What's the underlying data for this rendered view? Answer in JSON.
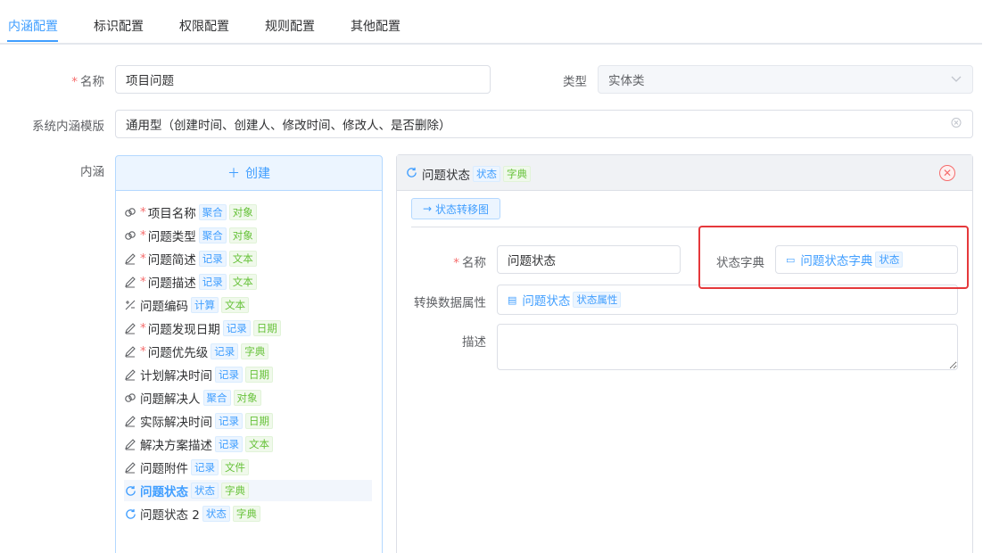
{
  "tabs": [
    {
      "label": "内涵配置",
      "active": true
    },
    {
      "label": "标识配置",
      "active": false
    },
    {
      "label": "权限配置",
      "active": false
    },
    {
      "label": "规则配置",
      "active": false
    },
    {
      "label": "其他配置",
      "active": false
    }
  ],
  "form": {
    "name_label": "名称",
    "name_value": "项目问题",
    "type_label": "类型",
    "type_value": "实体类",
    "template_label": "系统内涵模版",
    "template_value": "通用型（创建时间、创建人、修改时间、修改人、是否删除）",
    "connotation_label": "内涵",
    "create_button": "创建"
  },
  "items": [
    {
      "icon": "link-icon",
      "required": true,
      "label": "项目名称",
      "tags": [
        {
          "text": "聚合",
          "color": "blue"
        },
        {
          "text": "对象",
          "color": "green"
        }
      ]
    },
    {
      "icon": "link-icon",
      "required": true,
      "label": "问题类型",
      "tags": [
        {
          "text": "聚合",
          "color": "blue"
        },
        {
          "text": "对象",
          "color": "green"
        }
      ]
    },
    {
      "icon": "edit-icon",
      "required": true,
      "label": "问题简述",
      "tags": [
        {
          "text": "记录",
          "color": "blue"
        },
        {
          "text": "文本",
          "color": "green"
        }
      ]
    },
    {
      "icon": "edit-icon",
      "required": true,
      "label": "问题描述",
      "tags": [
        {
          "text": "记录",
          "color": "blue"
        },
        {
          "text": "文本",
          "color": "green"
        }
      ]
    },
    {
      "icon": "calc-icon",
      "required": false,
      "label": "问题编码",
      "tags": [
        {
          "text": "计算",
          "color": "blue"
        },
        {
          "text": "文本",
          "color": "green"
        }
      ]
    },
    {
      "icon": "edit-icon",
      "required": true,
      "label": "问题发现日期",
      "tags": [
        {
          "text": "记录",
          "color": "blue"
        },
        {
          "text": "日期",
          "color": "green"
        }
      ]
    },
    {
      "icon": "edit-icon",
      "required": true,
      "label": "问题优先级",
      "tags": [
        {
          "text": "记录",
          "color": "blue"
        },
        {
          "text": "字典",
          "color": "green"
        }
      ]
    },
    {
      "icon": "edit-icon",
      "required": false,
      "label": "计划解决时间",
      "tags": [
        {
          "text": "记录",
          "color": "blue"
        },
        {
          "text": "日期",
          "color": "green"
        }
      ]
    },
    {
      "icon": "link-icon",
      "required": false,
      "label": "问题解决人",
      "tags": [
        {
          "text": "聚合",
          "color": "blue"
        },
        {
          "text": "对象",
          "color": "green"
        }
      ]
    },
    {
      "icon": "edit-icon",
      "required": false,
      "label": "实际解决时间",
      "tags": [
        {
          "text": "记录",
          "color": "blue"
        },
        {
          "text": "日期",
          "color": "green"
        }
      ]
    },
    {
      "icon": "edit-icon",
      "required": false,
      "label": "解决方案描述",
      "tags": [
        {
          "text": "记录",
          "color": "blue"
        },
        {
          "text": "文本",
          "color": "green"
        }
      ]
    },
    {
      "icon": "edit-icon",
      "required": false,
      "label": "问题附件",
      "tags": [
        {
          "text": "记录",
          "color": "blue"
        },
        {
          "text": "文件",
          "color": "green"
        }
      ]
    },
    {
      "icon": "refresh-icon",
      "required": false,
      "label": "问题状态",
      "selected": true,
      "tags": [
        {
          "text": "状态",
          "color": "blue"
        },
        {
          "text": "字典",
          "color": "green"
        }
      ]
    },
    {
      "icon": "refresh-icon",
      "required": false,
      "label": "问题状态 2",
      "tags": [
        {
          "text": "状态",
          "color": "blue"
        },
        {
          "text": "字典",
          "color": "green"
        }
      ]
    }
  ],
  "panel": {
    "title": "问题状态",
    "tag1": "状态",
    "tag2": "字典",
    "transition_button": "状态转移图",
    "name_label": "名称",
    "name_value": "问题状态",
    "dict_label": "状态字典",
    "dict_value": "问题状态字典",
    "dict_tag": "状态",
    "convert_label": "转换数据属性",
    "convert_value": "问题状态",
    "convert_tag": "状态属性",
    "desc_label": "描述",
    "desc_value": ""
  },
  "colors": {
    "accent": "#409eff",
    "required": "#f56c6c",
    "highlight": "#e5383b"
  }
}
